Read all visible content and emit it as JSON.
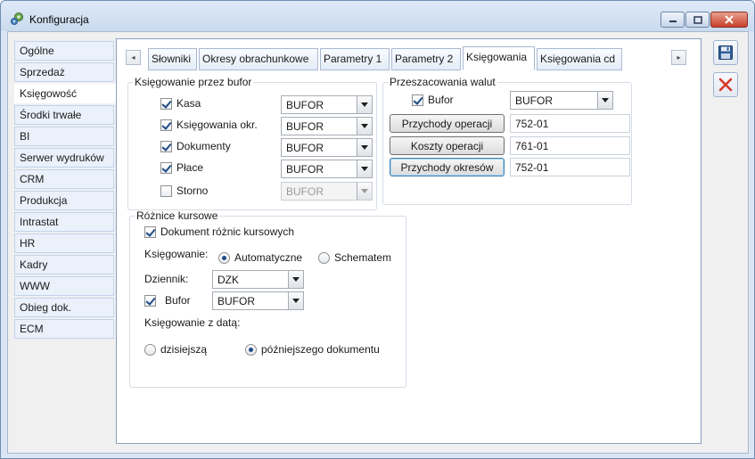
{
  "window": {
    "title": "Konfiguracja"
  },
  "nav": {
    "items": [
      {
        "label": "Ogólne"
      },
      {
        "label": "Sprzedaż"
      },
      {
        "label": "Księgowość"
      },
      {
        "label": "Środki trwałe"
      },
      {
        "label": "BI"
      },
      {
        "label": "Serwer wydruków"
      },
      {
        "label": "CRM"
      },
      {
        "label": "Produkcja"
      },
      {
        "label": "Intrastat"
      },
      {
        "label": "HR"
      },
      {
        "label": "Kadry"
      },
      {
        "label": "WWW"
      },
      {
        "label": "Obieg dok."
      },
      {
        "label": "ECM"
      }
    ],
    "active_index": 2
  },
  "tabs": {
    "items": [
      {
        "label": "Słowniki"
      },
      {
        "label": "Okresy obrachunkowe"
      },
      {
        "label": "Parametry 1"
      },
      {
        "label": "Parametry 2"
      },
      {
        "label": "Księgowania"
      },
      {
        "label": "Księgowania cd"
      }
    ],
    "active_index": 4
  },
  "bufor_group": {
    "legend": "Księgowanie przez bufor",
    "rows": [
      {
        "label": "Kasa",
        "checked": true,
        "value": "BUFOR",
        "enabled": true
      },
      {
        "label": "Księgowania okr.",
        "checked": true,
        "value": "BUFOR",
        "enabled": true
      },
      {
        "label": "Dokumenty",
        "checked": true,
        "value": "BUFOR",
        "enabled": true
      },
      {
        "label": "Płace",
        "checked": true,
        "value": "BUFOR",
        "enabled": true
      },
      {
        "label": "Storno",
        "checked": false,
        "value": "BUFOR",
        "enabled": false
      }
    ]
  },
  "waluty_group": {
    "legend": "Przeszacowania walut",
    "bufor_label": "Bufor",
    "bufor_checked": true,
    "bufor_value": "BUFOR",
    "buttons": [
      {
        "label": "Przychody operacji",
        "value": "752-01"
      },
      {
        "label": "Koszty operacji",
        "value": "761-01"
      },
      {
        "label": "Przychody okresów",
        "value": "752-01"
      }
    ]
  },
  "roznice_group": {
    "legend": "Różnice kursowe",
    "dokument_label": "Dokument różnic kursowych",
    "dokument_checked": true,
    "ksiegowanie_label": "Księgowanie:",
    "radio_auto": "Automatyczne",
    "radio_schemat": "Schematem",
    "dziennik_label": "Dziennik:",
    "dziennik_value": "DZK",
    "bufor_label": "Bufor",
    "bufor_checked": true,
    "bufor_value": "BUFOR",
    "data_label": "Księgowanie z datą:",
    "radio_dzis": "dzisiejszą",
    "radio_pozn": "późniejszego dokumentu"
  },
  "toolbar": {
    "save_icon": "save-icon",
    "cancel_icon": "cancel-icon"
  },
  "colors": {
    "accent": "#1e4a86",
    "close_red": "#d9372a"
  }
}
